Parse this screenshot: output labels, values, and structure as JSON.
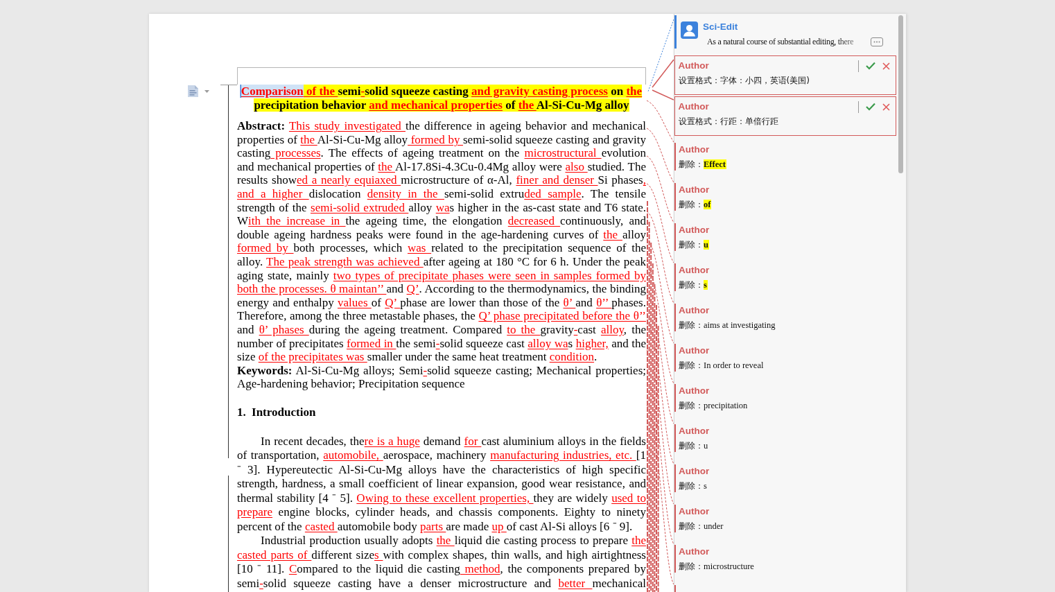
{
  "document": {
    "title": {
      "highlighted": true,
      "runs": [
        {
          "text": "Comparison",
          "inserted": true,
          "selected": true
        },
        {
          "text": " of the ",
          "inserted": true,
          "selected": false
        },
        {
          "text": "semi",
          "inserted": false,
          "selected": false
        },
        {
          "text": "-",
          "inserted": true,
          "selected": false
        },
        {
          "text": "solid squeeze casting ",
          "inserted": false,
          "selected": false
        },
        {
          "text": "and gravity casting process",
          "inserted": true,
          "selected": false
        },
        {
          "text": " on ",
          "inserted": false,
          "selected": false
        },
        {
          "text": "the",
          "inserted": true,
          "selected": false
        },
        {
          "text": " precipitation behavior ",
          "inserted": false,
          "selected": false
        },
        {
          "text": "and mechanical properties",
          "inserted": true,
          "selected": false
        },
        {
          "text": " of ",
          "inserted": false,
          "selected": false
        },
        {
          "text": "the ",
          "inserted": true,
          "selected": false
        },
        {
          "text": "Al-Si-Cu-Mg alloy",
          "inserted": false,
          "selected": false
        }
      ]
    },
    "paragraphs": [
      {
        "kind": "abstract",
        "runs": [
          {
            "text": "**Abstract:** ",
            "inserted": false
          },
          {
            "text": "This study investigated ",
            "inserted": true
          },
          {
            "text": "the difference in ageing behavior and mechanical properties of ",
            "inserted": false
          },
          {
            "text": "the ",
            "inserted": true
          },
          {
            "text": "Al-Si-Cu-Mg alloy",
            "inserted": false
          },
          {
            "text": " formed by ",
            "inserted": true
          },
          {
            "text": "semi-solid squeeze casting and gravity casting",
            "inserted": false
          },
          {
            "text": " processes",
            "inserted": true
          },
          {
            "text": ". The effects of ageing treatment on the ",
            "inserted": false
          },
          {
            "text": "microstructural ",
            "inserted": true
          },
          {
            "text": "evolution and mechanical properties of ",
            "inserted": false
          },
          {
            "text": "the ",
            "inserted": true
          },
          {
            "text": "Al-17.8Si-4.3Cu-0.4Mg alloy were ",
            "inserted": false
          },
          {
            "text": "also ",
            "inserted": true
          },
          {
            "text": "studied. The results show",
            "inserted": false
          },
          {
            "text": "ed a nearly equiaxed ",
            "inserted": true
          },
          {
            "text": "microstructure of α-Al, ",
            "inserted": false
          },
          {
            "text": "finer and denser ",
            "inserted": true
          },
          {
            "text": "Si phases",
            "inserted": false
          },
          {
            "text": ", and a higher ",
            "inserted": true
          },
          {
            "text": "dislocation ",
            "inserted": false
          },
          {
            "text": "density in the ",
            "inserted": true
          },
          {
            "text": "semi-solid extru",
            "inserted": false
          },
          {
            "text": "ded sample",
            "inserted": true
          },
          {
            "text": ". The tensile strength of the ",
            "inserted": false
          },
          {
            "text": "semi-solid extruded ",
            "inserted": true
          },
          {
            "text": "alloy ",
            "inserted": false
          },
          {
            "text": "wa",
            "inserted": true
          },
          {
            "text": "s higher in the as-cast state and T6 state. W",
            "inserted": false
          },
          {
            "text": "ith the increase in ",
            "inserted": true
          },
          {
            "text": "the ageing time, the elongation ",
            "inserted": false
          },
          {
            "text": "decreased ",
            "inserted": true
          },
          {
            "text": "continuously, and double ageing hardness peaks were found in the age-hardening curves of ",
            "inserted": false
          },
          {
            "text": "the ",
            "inserted": true
          },
          {
            "text": "alloy ",
            "inserted": false
          },
          {
            "text": "formed by ",
            "inserted": true
          },
          {
            "text": "both processes, which ",
            "inserted": false
          },
          {
            "text": "was ",
            "inserted": true
          },
          {
            "text": "related to the precipitation sequence of the alloy. ",
            "inserted": false
          },
          {
            "text": "The peak strength was achieved ",
            "inserted": true
          },
          {
            "text": "after ageing at 180 °C for 6 h. Under the peak aging state, mainly ",
            "inserted": false
          },
          {
            "text": "two types of precipitate phases were seen in samples formed by both the processes. θ maintan’’ ",
            "inserted": true
          },
          {
            "text": "and ",
            "inserted": false
          },
          {
            "text": "Q’",
            "inserted": true
          },
          {
            "text": ". According to the thermodynamics, the binding energy and enthalpy ",
            "inserted": false
          },
          {
            "text": "values ",
            "inserted": true
          },
          {
            "text": "of ",
            "inserted": false
          },
          {
            "text": "Q’ ",
            "inserted": true
          },
          {
            "text": "phase are lower than those of the ",
            "inserted": false
          },
          {
            "text": "θ’ ",
            "inserted": true
          },
          {
            "text": "and ",
            "inserted": false
          },
          {
            "text": "θ’’ ",
            "inserted": true
          },
          {
            "text": "phases. Therefore, among the three metastable phases, the ",
            "inserted": false
          },
          {
            "text": "Q’ phase precipitated before the θ’’ ",
            "inserted": true
          },
          {
            "text": "and ",
            "inserted": false
          },
          {
            "text": "θ’ phases ",
            "inserted": true
          },
          {
            "text": "during the ageing treatment. Compared ",
            "inserted": false
          },
          {
            "text": "to the ",
            "inserted": true
          },
          {
            "text": "gravity",
            "inserted": false
          },
          {
            "text": "-",
            "inserted": true
          },
          {
            "text": "cast ",
            "inserted": false
          },
          {
            "text": "alloy",
            "inserted": true
          },
          {
            "text": ", the number of precipitates ",
            "inserted": false
          },
          {
            "text": "formed in ",
            "inserted": true
          },
          {
            "text": "the semi",
            "inserted": false
          },
          {
            "text": "-",
            "inserted": true
          },
          {
            "text": "solid squeeze cast ",
            "inserted": false
          },
          {
            "text": "alloy wa",
            "inserted": true
          },
          {
            "text": "s ",
            "inserted": false
          },
          {
            "text": "higher,",
            "inserted": true
          },
          {
            "text": " and the size ",
            "inserted": false
          },
          {
            "text": "of the precipitates was ",
            "inserted": true
          },
          {
            "text": "smaller under the same heat treatment ",
            "inserted": false
          },
          {
            "text": "condition",
            "inserted": true
          },
          {
            "text": ".",
            "inserted": false
          }
        ]
      },
      {
        "kind": "keywords",
        "runs": [
          {
            "text": "**Keywords:** Al-Si-Cu-Mg alloys; Semi",
            "inserted": false
          },
          {
            "text": "-",
            "inserted": true
          },
          {
            "text": "solid squeeze casting; Mechanical properties; Age-hardening behavior; Precipitation sequence",
            "inserted": false
          }
        ]
      },
      {
        "kind": "heading",
        "number": "1.",
        "title": "Introduction"
      },
      {
        "kind": "body",
        "runs": [
          {
            "text": "In recent decades, the",
            "inserted": false
          },
          {
            "text": "re is a huge",
            "inserted": true
          },
          {
            "text": " demand ",
            "inserted": false
          },
          {
            "text": "for ",
            "inserted": true
          },
          {
            "text": "cast aluminium alloys in the fields of transportation, ",
            "inserted": false
          },
          {
            "text": "automobile, ",
            "inserted": true
          },
          {
            "text": "aerospace, machinery ",
            "inserted": false
          },
          {
            "text": "manufacturing industries, etc. ",
            "inserted": true
          },
          {
            "text": "[1 ⁻ 3]. Hypereutectic Al-Si-Cu-Mg alloys have the characteristics of high specific strength, hardness, a small coefficient of linear expansion, good wear resistance, and thermal stability [4 ⁻ 5]. ",
            "inserted": false
          },
          {
            "text": "Owing to these excellent properties, ",
            "inserted": true
          },
          {
            "text": "they are widely ",
            "inserted": false
          },
          {
            "text": "used to prepare",
            "inserted": true
          },
          {
            "text": " engine blocks, cylinder heads, and chassis components. Eighty to ninety percent of the ",
            "inserted": false
          },
          {
            "text": "casted ",
            "inserted": true
          },
          {
            "text": "automobile body ",
            "inserted": false
          },
          {
            "text": "parts ",
            "inserted": true
          },
          {
            "text": "are made ",
            "inserted": false
          },
          {
            "text": "up ",
            "inserted": true
          },
          {
            "text": "of cast Al-Si alloys [6 ⁻ 9].",
            "inserted": false
          }
        ]
      },
      {
        "kind": "body",
        "continues": true,
        "runs": [
          {
            "text": "Industrial production usually adopts ",
            "inserted": false
          },
          {
            "text": "the ",
            "inserted": true
          },
          {
            "text": "liquid die casting process to prepare ",
            "inserted": false
          },
          {
            "text": "the casted parts of ",
            "inserted": true
          },
          {
            "text": "different size",
            "inserted": false
          },
          {
            "text": "s ",
            "inserted": true
          },
          {
            "text": "with complex shapes, thin walls, and high airtightness [10 ⁻ 11]. ",
            "inserted": false
          },
          {
            "text": "C",
            "inserted": true
          },
          {
            "text": "ompared to the liquid die casting",
            "inserted": false
          },
          {
            "text": " method",
            "inserted": true
          },
          {
            "text": ", the components prepared by semi",
            "inserted": false
          },
          {
            "text": "-",
            "inserted": true
          },
          {
            "text": "solid squeeze casting have a denser microstructure and ",
            "inserted": false
          },
          {
            "text": "better ",
            "inserted": true
          },
          {
            "text": "mechanical",
            "inserted": false
          }
        ]
      }
    ]
  },
  "comments_pane": {
    "comment": {
      "author": "Sci-Edit",
      "text": "As a natural course of substantial editing, there"
    },
    "changes": [
      {
        "kind": "format",
        "author": "Author",
        "text": "设置格式：字体：小四，英语(美国)"
      },
      {
        "kind": "format",
        "author": "Author",
        "text": "设置格式：行距：单倍行距"
      },
      {
        "kind": "delete",
        "author": "Author",
        "label": "删除：",
        "deleted": "Effect",
        "highlighted": true,
        "bold": true
      },
      {
        "kind": "delete",
        "author": "Author",
        "label": "删除：",
        "deleted": "of",
        "highlighted": true,
        "bold": true
      },
      {
        "kind": "delete",
        "author": "Author",
        "label": "删除：",
        "deleted": "u",
        "highlighted": true,
        "bold": true
      },
      {
        "kind": "delete",
        "author": "Author",
        "label": "删除：",
        "deleted": "s",
        "highlighted": true,
        "bold": true
      },
      {
        "kind": "delete",
        "author": "Author",
        "label": "删除：",
        "deleted": "aims at investigating",
        "highlighted": false,
        "bold": false
      },
      {
        "kind": "delete",
        "author": "Author",
        "label": "删除：",
        "deleted": "In order to reveal",
        "highlighted": false,
        "bold": false
      },
      {
        "kind": "delete",
        "author": "Author",
        "label": "删除：",
        "deleted": "precipitation",
        "highlighted": false,
        "bold": false
      },
      {
        "kind": "delete",
        "author": "Author",
        "label": "删除：",
        "deleted": "u",
        "highlighted": false,
        "bold": false
      },
      {
        "kind": "delete",
        "author": "Author",
        "label": "删除：",
        "deleted": "s",
        "highlighted": false,
        "bold": false
      },
      {
        "kind": "delete",
        "author": "Author",
        "label": "删除：",
        "deleted": "under",
        "highlighted": false,
        "bold": false
      },
      {
        "kind": "delete",
        "author": "Author",
        "label": "删除：",
        "deleted": "microstructure",
        "highlighted": false,
        "bold": false
      },
      {
        "kind": "delete"
      }
    ]
  }
}
